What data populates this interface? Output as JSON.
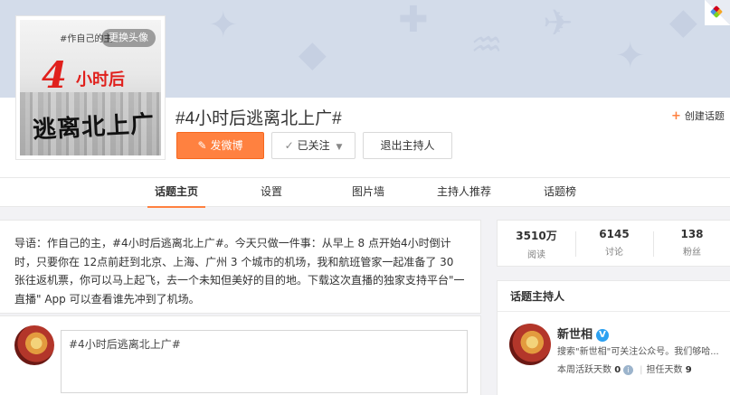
{
  "avatar": {
    "swap_label": "更换头像",
    "hash_text": "#作自己的主",
    "big_text": "4",
    "sub_text": "小时后",
    "cal_text": "逃离北上广"
  },
  "header": {
    "title": "#4小时后逃离北上广#",
    "post_button": "发微博",
    "follow_button": "已关注",
    "quit_button": "退出主持人",
    "create_topic": "创建话题"
  },
  "nav": {
    "items": [
      "话题主页",
      "设置",
      "图片墙",
      "主持人推荐",
      "话题榜"
    ],
    "active_index": 0
  },
  "intro": {
    "text": "导语：作自己的主，#4小时后逃离北上广#。今天只做一件事：从早上 8 点开始4小时倒计时，只要你在 12点前赶到北京、上海、广州 3 个城市的机场，我和航班管家一起准备了 30 张往返机票，你可以马上起飞，去一个未知但美好的目的地。下载这次直播的独家支持平台\"一直播\" App 可以查看谁先冲到了机场。"
  },
  "composer": {
    "value": "#4小时后逃离北上广#"
  },
  "stats": [
    {
      "num": "3510万",
      "label": "阅读"
    },
    {
      "num": "6145",
      "label": "讨论"
    },
    {
      "num": "138",
      "label": "粉丝"
    }
  ],
  "host": {
    "heading": "话题主持人",
    "name": "新世相",
    "desc": "搜索\"新世相\"可关注公众号。我们够哈...",
    "week_active_label": "本周活跃天数",
    "week_active_value": "0",
    "host_days_label": "担任天数",
    "host_days_value": "9"
  },
  "colors": {
    "accent": "#ff8140",
    "banner": "#d3dcea",
    "verified": "#2da1f1"
  },
  "icons": [
    "post-icon",
    "check-icon",
    "chevron-down-icon",
    "plus-icon",
    "verified-icon",
    "info-icon"
  ]
}
